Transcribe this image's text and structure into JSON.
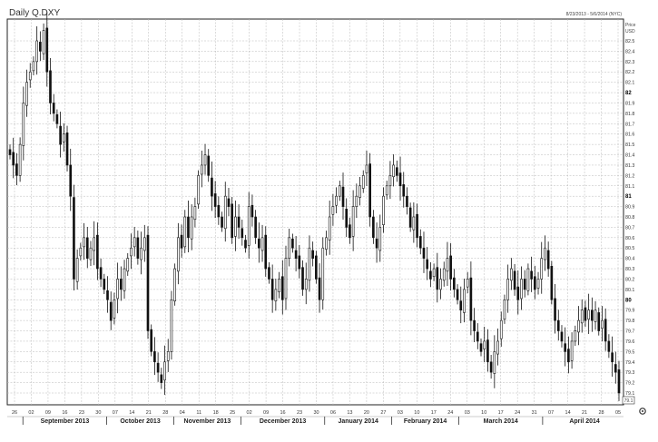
{
  "chart_data": {
    "type": "candlestick",
    "title": "Daily Q.DXY",
    "date_range": "8/23/2013 - 5/6/2014 (NYC)",
    "ylabel": "Price",
    "yunit": "USD",
    "ylim": [
      79.0,
      82.7
    ],
    "last_price": "79.1",
    "y_ticks": [
      "82.5",
      "82.4",
      "82.3",
      "82.2",
      "82.1",
      "82",
      "81.9",
      "81.8",
      "81.7",
      "81.6",
      "81.5",
      "81.4",
      "81.3",
      "81.2",
      "81.1",
      "81",
      "80.9",
      "80.8",
      "80.7",
      "80.6",
      "80.5",
      "80.4",
      "80.3",
      "80.2",
      "80.1",
      "80",
      "79.9",
      "79.8",
      "79.7",
      "79.6",
      "79.5",
      "79.4",
      "79.3",
      "79.2",
      "79.1"
    ],
    "x_day_labels": [
      "26",
      "02",
      "09",
      "16",
      "23",
      "30",
      "07",
      "14",
      "21",
      "28",
      "04",
      "11",
      "18",
      "25",
      "02",
      "09",
      "16",
      "23",
      "30",
      "06",
      "13",
      "20",
      "27",
      "03",
      "10",
      "17",
      "24",
      "03",
      "10",
      "17",
      "24",
      "31",
      "07",
      "14",
      "21",
      "28",
      "05"
    ],
    "x_month_labels": [
      "September 2013",
      "October 2013",
      "November 2013",
      "December 2013",
      "January 2014",
      "February 2014",
      "March 2014",
      "April 2014"
    ],
    "grid": true,
    "closes": [
      81.4,
      81.3,
      81.2,
      81.5,
      81.9,
      82.1,
      82.2,
      82.3,
      82.5,
      82.4,
      82.6,
      82.2,
      81.9,
      81.8,
      81.7,
      81.5,
      81.6,
      81.3,
      81.0,
      80.2,
      80.4,
      80.5,
      80.6,
      80.4,
      80.5,
      80.6,
      80.3,
      80.2,
      80.1,
      80.0,
      79.8,
      80.0,
      80.2,
      80.1,
      80.3,
      80.4,
      80.5,
      80.6,
      80.4,
      80.5,
      80.6,
      79.7,
      79.5,
      79.4,
      79.3,
      79.2,
      79.4,
      79.5,
      80.0,
      80.3,
      80.6,
      80.5,
      80.8,
      80.6,
      80.8,
      80.9,
      81.2,
      81.3,
      81.4,
      81.2,
      81.0,
      80.9,
      80.8,
      80.7,
      81.0,
      80.9,
      80.6,
      80.8,
      80.7,
      80.6,
      80.5,
      80.9,
      80.8,
      80.6,
      80.5,
      80.6,
      80.3,
      80.2,
      80.0,
      80.1,
      80.2,
      80.0,
      80.4,
      80.6,
      80.5,
      80.4,
      80.3,
      80.1,
      80.2,
      80.5,
      80.4,
      80.2,
      80.0,
      80.5,
      80.6,
      80.8,
      80.9,
      81.0,
      81.1,
      80.9,
      80.7,
      80.6,
      80.9,
      81.0,
      81.1,
      81.2,
      81.3,
      80.8,
      80.6,
      80.5,
      80.7,
      81.0,
      81.1,
      81.2,
      81.3,
      81.2,
      81.1,
      81.0,
      80.9,
      80.7,
      80.8,
      80.6,
      80.5,
      80.4,
      80.3,
      80.2,
      80.3,
      80.1,
      80.2,
      80.3,
      80.4,
      80.2,
      80.1,
      80.0,
      79.9,
      80.1,
      80.2,
      79.8,
      79.7,
      79.6,
      79.5,
      79.6,
      79.4,
      79.3,
      79.5,
      79.6,
      79.8,
      80.0,
      80.2,
      80.3,
      80.1,
      80.0,
      80.2,
      80.1,
      80.3,
      80.2,
      80.1,
      80.2,
      80.4,
      80.5,
      80.3,
      80.0,
      79.8,
      79.7,
      79.6,
      79.5,
      79.4,
      79.6,
      79.7,
      79.8,
      79.9,
      79.8,
      79.9,
      79.8,
      79.9,
      79.7,
      79.8,
      79.6,
      79.5,
      79.4,
      79.3,
      79.1
    ]
  },
  "colors": {
    "candle": "#111111",
    "grid": "#b8b8b8",
    "frame": "#222222"
  }
}
